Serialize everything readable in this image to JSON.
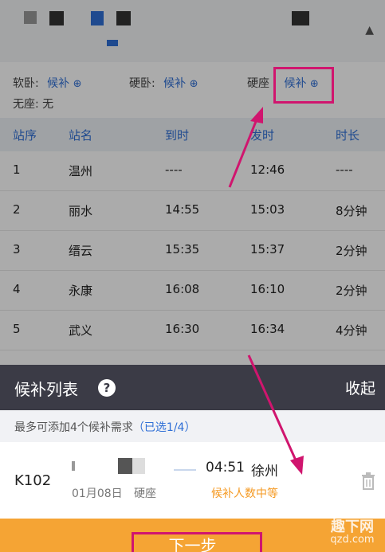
{
  "top": {
    "partial_text": "K102",
    "partial_label": "旦 暂 l"
  },
  "seats": {
    "soft_sleeper": {
      "label": "软卧:",
      "value": "候补"
    },
    "hard_sleeper": {
      "label": "硬卧:",
      "value": "候补"
    },
    "hard_seat": {
      "label": "硬座",
      "value": "候补"
    },
    "no_seat": "无座: 无"
  },
  "table": {
    "headers": [
      "站序",
      "站名",
      "到时",
      "发时",
      "时长"
    ],
    "rows": [
      {
        "no": "1",
        "station": "温州",
        "arrive": "----",
        "depart": "12:46",
        "duration": "----"
      },
      {
        "no": "2",
        "station": "丽水",
        "arrive": "14:55",
        "depart": "15:03",
        "duration": "8分钟"
      },
      {
        "no": "3",
        "station": "缙云",
        "arrive": "15:35",
        "depart": "15:37",
        "duration": "2分钟"
      },
      {
        "no": "4",
        "station": "永康",
        "arrive": "16:08",
        "depart": "16:10",
        "duration": "2分钟"
      },
      {
        "no": "5",
        "station": "武义",
        "arrive": "16:30",
        "depart": "16:34",
        "duration": "4分钟"
      }
    ]
  },
  "sheet": {
    "title": "候补列表",
    "help_glyph": "?",
    "collapse": "收起",
    "hint_prefix": "最多可添加4个候补需求",
    "hint_selected": "（已选1/4）"
  },
  "order": {
    "train_no": "K102",
    "arrive_time": "04:51",
    "arrive_station": "徐州",
    "date": "01月08日",
    "seat_type": "硬座",
    "status": "候补人数中等"
  },
  "next_button": "下一步",
  "watermark": {
    "line1": "趣下网",
    "line2": "qzd.com"
  },
  "colors": {
    "accent": "#2f6fd6",
    "orange": "#f5a434",
    "status_orange": "#f59a23",
    "sheet_header": "#3b3b46",
    "annotation": "#d0156e"
  },
  "icons": {
    "help": "question-circle-icon",
    "trash": "trash-icon",
    "plus": "plus-circle-icon",
    "chevron": "chevron-up-icon"
  }
}
